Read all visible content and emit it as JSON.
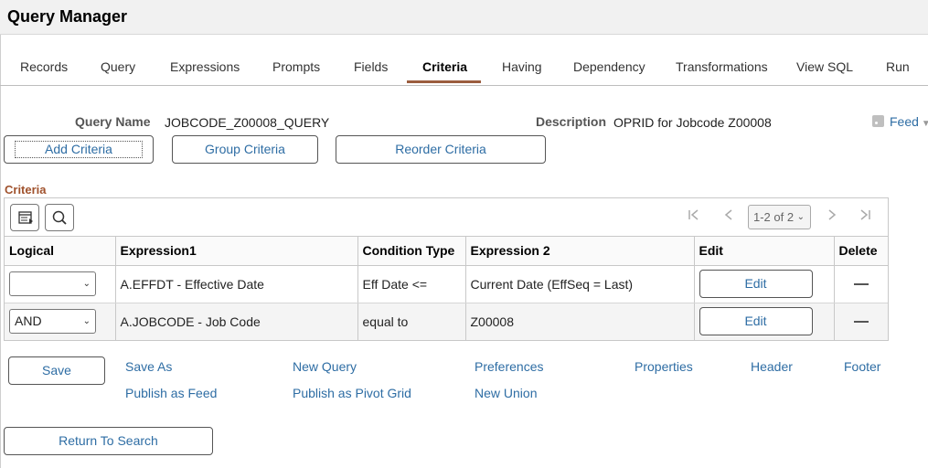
{
  "header": {
    "title": "Query Manager"
  },
  "tabs": [
    {
      "label": "Records"
    },
    {
      "label": "Query"
    },
    {
      "label": "Expressions"
    },
    {
      "label": "Prompts"
    },
    {
      "label": "Fields"
    },
    {
      "label": "Criteria"
    },
    {
      "label": "Having"
    },
    {
      "label": "Dependency"
    },
    {
      "label": "Transformations"
    },
    {
      "label": "View SQL"
    },
    {
      "label": "Run"
    }
  ],
  "active_tab": "Criteria",
  "query": {
    "name_label": "Query Name",
    "name_value": "JOBCODE_Z00008_QUERY",
    "description_label": "Description",
    "description_value": "OPRID for Jobcode Z00008"
  },
  "feed": {
    "label": "Feed"
  },
  "actions": {
    "add_criteria": "Add Criteria",
    "group_criteria": "Group Criteria",
    "reorder_criteria": "Reorder Criteria"
  },
  "criteria": {
    "section_title": "Criteria",
    "pager": "1-2 of 2",
    "columns": {
      "logical": "Logical",
      "expression1": "Expression1",
      "condition_type": "Condition Type",
      "expression2": "Expression 2",
      "edit": "Edit",
      "delete": "Delete"
    },
    "rows": [
      {
        "logical": "",
        "expression1": "A.EFFDT - Effective Date",
        "condition_type": "Eff Date <=",
        "expression2": "Current Date (EffSeq = Last)",
        "edit_label": "Edit"
      },
      {
        "logical": "AND",
        "expression1": "A.JOBCODE - Job Code",
        "condition_type": "equal to",
        "expression2": "Z00008",
        "edit_label": "Edit"
      }
    ]
  },
  "footer": {
    "save": "Save",
    "save_as": "Save As",
    "new_query": "New Query",
    "preferences": "Preferences",
    "properties": "Properties",
    "header": "Header",
    "footer": "Footer",
    "publish_as_feed": "Publish as Feed",
    "publish_as_pivot_grid": "Publish as Pivot Grid",
    "new_union": "New Union",
    "return_to_search": "Return To Search"
  },
  "colors": {
    "link": "#2e6da4",
    "section_title": "#a0522d",
    "active_tab_underline": "#9b5d3f"
  }
}
